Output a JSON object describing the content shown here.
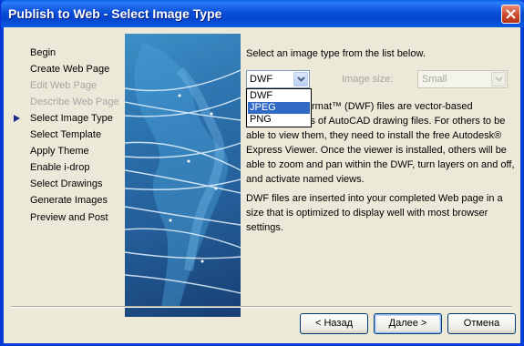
{
  "window": {
    "title": "Publish to Web - Select Image Type"
  },
  "steps": [
    {
      "label": "Begin",
      "state": "normal"
    },
    {
      "label": "Create Web Page",
      "state": "normal"
    },
    {
      "label": "Edit Web Page",
      "state": "disabled"
    },
    {
      "label": "Describe Web Page",
      "state": "disabled"
    },
    {
      "label": "Select Image Type",
      "state": "current"
    },
    {
      "label": "Select Template",
      "state": "normal"
    },
    {
      "label": "Apply Theme",
      "state": "normal"
    },
    {
      "label": "Enable i-drop",
      "state": "normal"
    },
    {
      "label": "Select Drawings",
      "state": "normal"
    },
    {
      "label": "Generate Images",
      "state": "normal"
    },
    {
      "label": "Preview and Post",
      "state": "normal"
    }
  ],
  "content": {
    "instruction": "Select an image type from the list below.",
    "image_type": {
      "value": "DWF",
      "options": [
        "DWF",
        "JPEG",
        "PNG"
      ],
      "highlighted": "JPEG"
    },
    "image_size": {
      "label": "Image size:",
      "value": "Small"
    },
    "description": [
      "rmat™ (DWF) files are vector-based",
      "representations of AutoCAD drawing files.  For others to be",
      "able to view them, they need to install the free Autodesk®",
      "Express Viewer.  Once the viewer is installed, others will be",
      "able to zoom and pan within the DWF, turn layers on and off,",
      "and activate named views.",
      "",
      "DWF files are inserted into your completed Web page in a",
      "size that is optimized to display well with most browser",
      "settings."
    ]
  },
  "buttons": {
    "back": "< Назад",
    "next": "Далее >",
    "cancel": "Отмена"
  },
  "colors": {
    "title_bar": "#0a4fd8",
    "selection": "#316ac5",
    "disabled_text": "#a7a6a3"
  }
}
